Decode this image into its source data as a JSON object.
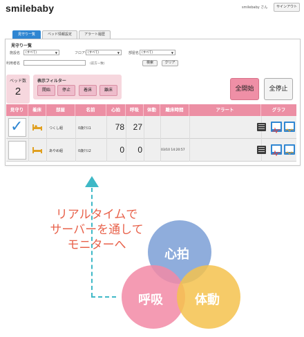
{
  "header": {
    "logo": "smilebaby",
    "user": "smilebaby さん",
    "logout": "サインアウト"
  },
  "tabs": [
    {
      "label": "見守り一覧",
      "active": true
    },
    {
      "label": "ベッド情報設定",
      "active": false
    },
    {
      "label": "アラート履歴",
      "active": false
    }
  ],
  "panel": {
    "title": "見守り一覧",
    "filters": {
      "facility_label": "施設名",
      "facility_value": "(すべて)",
      "floor_label": "フロア名",
      "floor_value": "(すべて)",
      "room_label": "部屋名",
      "room_value": "(すべて)",
      "user_label": "利用者名",
      "user_note": "(前方一致)",
      "search_button": "検索",
      "clear_button": "クリア"
    },
    "bed_count": {
      "label": "ベッド数",
      "value": "2"
    },
    "display_filter": {
      "title": "表示フィルター",
      "buttons": [
        "開始",
        "停止",
        "着床",
        "離床"
      ]
    },
    "start_all": "全開始",
    "stop_all": "全停止"
  },
  "table": {
    "headers": [
      "見守り",
      "着床",
      "部屋",
      "名前",
      "心拍",
      "呼吸",
      "体動",
      "離床時間",
      "アラート",
      "グラフ"
    ],
    "rows": [
      {
        "watching": true,
        "room": "つくし組",
        "name": "0歳ｸﾗｽ1",
        "heart_rate": "78",
        "respiration": "27",
        "body_movement": "",
        "leave_time": "",
        "alert_icon": "alert-list-icon",
        "graph_icons": [
          "heart-graph-icon",
          "respiration-graph-icon"
        ]
      },
      {
        "watching": false,
        "room": "あやめ組",
        "name": "0歳ｸﾗｽ2",
        "heart_rate": "0",
        "respiration": "0",
        "body_movement": "",
        "leave_time": "03/10 14:20:57",
        "alert_icon": "alert-list-icon",
        "graph_icons": [
          "heart-graph-icon",
          "respiration-graph-icon"
        ]
      }
    ]
  },
  "caption": [
    "リアルタイムで",
    "サーバーを通して",
    "モニターへ"
  ],
  "venn": {
    "labels": [
      "心拍",
      "呼吸",
      "体動"
    ],
    "colors": [
      "#7b9fd6",
      "#f28aa6",
      "#f5c24e"
    ]
  },
  "colors": {
    "accent_blue": "#2f86d2",
    "header_pink": "#ec8fa4",
    "filter_bg": "#f6d7de",
    "caption_orange": "#e8614a",
    "arrow_teal": "#3eb8c6"
  }
}
